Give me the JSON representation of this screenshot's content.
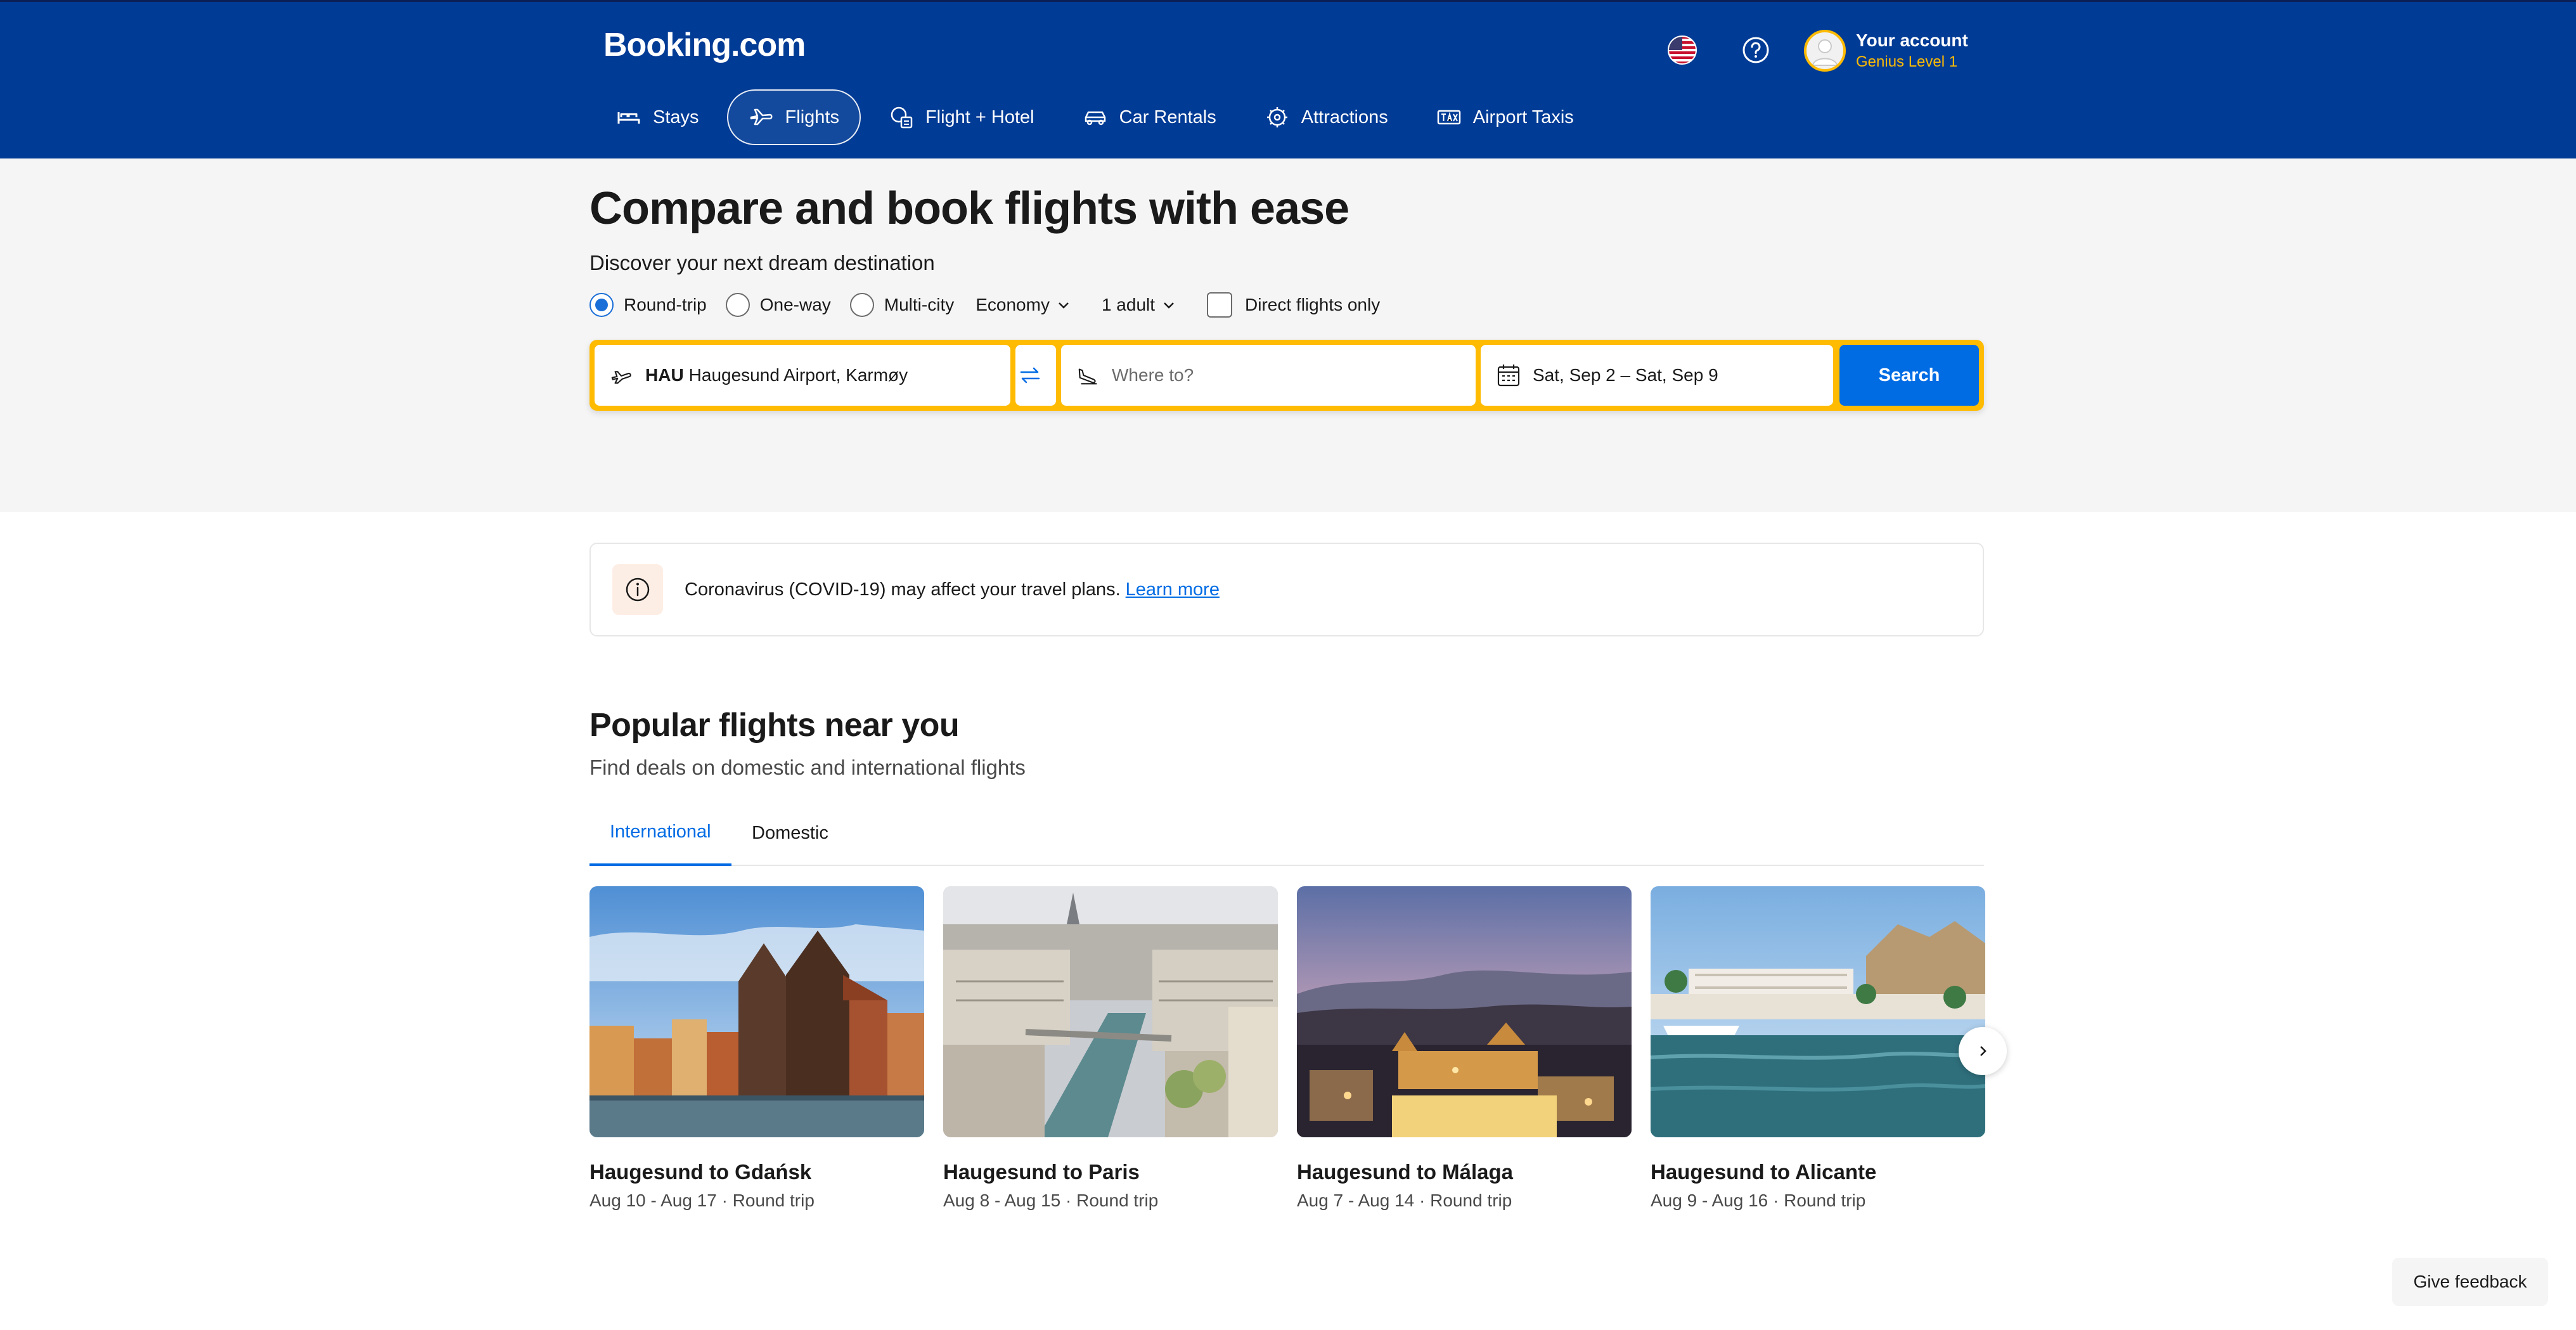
{
  "header": {
    "logo": "Booking.com",
    "account_name": "Your account",
    "account_level": "Genius Level 1",
    "icons": [
      "us-flag-icon",
      "help-icon",
      "avatar"
    ]
  },
  "nav": {
    "items": [
      {
        "label": "Stays",
        "icon": "bed-icon"
      },
      {
        "label": "Flights",
        "icon": "plane-icon",
        "active": true
      },
      {
        "label": "Flight + Hotel",
        "icon": "flight-hotel-icon"
      },
      {
        "label": "Car Rentals",
        "icon": "car-icon"
      },
      {
        "label": "Attractions",
        "icon": "attractions-icon"
      },
      {
        "label": "Airport Taxis",
        "icon": "taxi-icon"
      }
    ]
  },
  "hero": {
    "title": "Compare and book flights with ease",
    "subtitle": "Discover your next dream destination",
    "trip_types": [
      "Round-trip",
      "One-way",
      "Multi-city"
    ],
    "selected_trip_type": "Round-trip",
    "cabin_class": "Economy",
    "travellers": "1 adult",
    "direct_only_label": "Direct flights only",
    "direct_only_checked": false
  },
  "search": {
    "from_code": "HAU",
    "from_name": "Haugesund Airport, Karmøy",
    "to_placeholder": "Where to?",
    "dates": "Sat, Sep 2 – Sat, Sep 9",
    "button_label": "Search"
  },
  "notice": {
    "text": "Coronavirus (COVID-19) may affect your travel plans.",
    "link": "Learn more"
  },
  "popular": {
    "title": "Popular flights near you",
    "subtitle": "Find deals on domestic and international flights",
    "tabs": [
      "International",
      "Domestic"
    ],
    "active_tab": "International",
    "cards": [
      {
        "title": "Haugesund to Gdańsk",
        "meta": "Aug 10 - Aug 17 · Round trip"
      },
      {
        "title": "Haugesund to Paris",
        "meta": "Aug 8 - Aug 15 · Round trip"
      },
      {
        "title": "Haugesund to Málaga",
        "meta": "Aug 7 - Aug 14 · Round trip"
      },
      {
        "title": "Haugesund to Alicante",
        "meta": "Aug 9 - Aug 16 · Round trip"
      }
    ]
  },
  "feedback_label": "Give feedback",
  "colors": {
    "brand_blue": "#003b95",
    "accent_yellow": "#febb02",
    "action_blue": "#006ce4"
  }
}
